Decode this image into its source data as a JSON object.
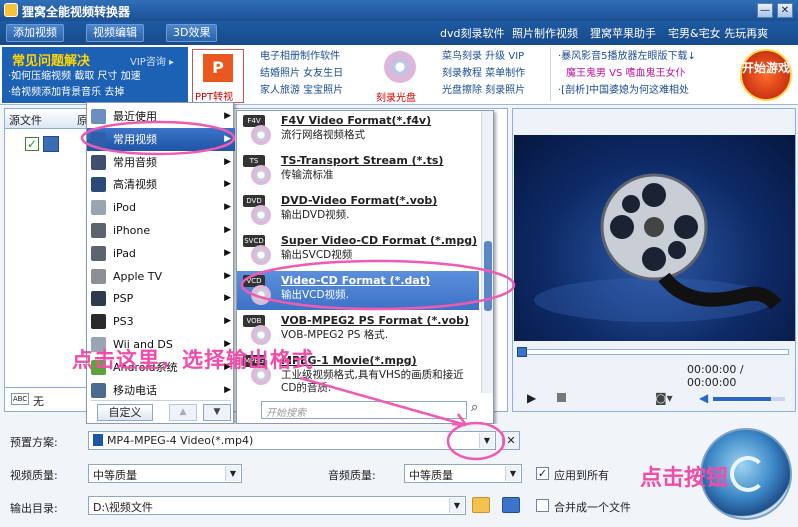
{
  "window": {
    "title": "狸窝全能视频转换器",
    "min_label": "—",
    "close_label": "✕"
  },
  "toolbar": {
    "buttons": [
      "添加视频",
      "视频编辑",
      "3D效果"
    ],
    "links": [
      "dvd刻录软件",
      "照片制作视频",
      "狸窝苹果助手",
      "宅男&宅女 先玩再爽"
    ]
  },
  "ads": {
    "faq_title": "常见问题解决",
    "vip": "VIP咨询 ▸",
    "faq_lines": [
      "·如何压缩视频 截取 尺寸 加速",
      "·给视频添加背景音乐 去掉"
    ],
    "ppt_label": "PPT转视频",
    "photo_lines": [
      "电子相册制作软件",
      "结婚照片 女友生日",
      "家人旅游 宝宝照片"
    ],
    "burn_label": "刻录光盘",
    "burn_lines": [
      "菜鸟刻录 升级 VIP",
      "刻录教程 菜单制作",
      "光盘擦除 刻录照片"
    ],
    "news_lines": [
      "·暴风影音5播放器左眼版下载↓",
      "魔王鬼男 VS 嗜血鬼王女仆",
      "·[剖析]中国婆媳为何这难相处"
    ],
    "game_label": "开始游戏"
  },
  "left_panel": {
    "col1": "源文件",
    "col2": "原",
    "audio_value": "无"
  },
  "menu1": {
    "items": [
      {
        "label": "最近使用",
        "icon": "clock-icon",
        "selected": false
      },
      {
        "label": "常用视频",
        "icon": "film-icon",
        "selected": true
      },
      {
        "label": "常用音频",
        "icon": "music-icon",
        "selected": false
      },
      {
        "label": "高清视频",
        "icon": "hd-icon",
        "selected": false
      },
      {
        "label": "iPod",
        "icon": "ipod-icon",
        "selected": false
      },
      {
        "label": "iPhone",
        "icon": "iphone-icon",
        "selected": false
      },
      {
        "label": "iPad",
        "icon": "ipad-icon",
        "selected": false
      },
      {
        "label": "Apple TV",
        "icon": "apple-icon",
        "selected": false
      },
      {
        "label": "PSP",
        "icon": "psp-icon",
        "selected": false
      },
      {
        "label": "PS3",
        "icon": "ps3-icon",
        "selected": false
      },
      {
        "label": "Wii and DS",
        "icon": "wii-icon",
        "selected": false
      },
      {
        "label": "Android系统",
        "icon": "android-icon",
        "selected": false
      },
      {
        "label": "移动电话",
        "icon": "phone-icon",
        "selected": false
      }
    ],
    "custom_label": "自定义",
    "up_label": "▲",
    "down_label": "▼"
  },
  "menu2": {
    "items": [
      {
        "title": "F4V Video Format(*.f4v)",
        "desc": "流行网络视频格式",
        "icon": "F4V",
        "selected": false
      },
      {
        "title": "TS-Transport Stream (*.ts)",
        "desc": "传输流标准",
        "icon": "TS",
        "selected": false
      },
      {
        "title": "DVD-Video Format(*.vob)",
        "desc": "输出DVD视频.",
        "icon": "DVD",
        "selected": false
      },
      {
        "title": "Super Video-CD Format (*.mpg)",
        "desc": "输出SVCD视频",
        "icon": "SVCD",
        "selected": false
      },
      {
        "title": "Video-CD Format (*.dat)",
        "desc": "输出VCD视频.",
        "icon": "VCD",
        "selected": true
      },
      {
        "title": "VOB-MPEG2 PS Format (*.vob)",
        "desc": "VOB-MPEG2 PS 格式.",
        "icon": "VOB",
        "selected": false
      },
      {
        "title": "MPEG-1 Movie(*.mpg)",
        "desc": "工业级视频格式,具有VHS的画质和接近CD的音质.",
        "icon": "MPEG",
        "selected": false
      }
    ],
    "search_placeholder": "开始搜索"
  },
  "preview": {
    "time": "00:00:00 / 00:00:00",
    "progress": 0,
    "volume": 0.8
  },
  "settings": {
    "preset_label": "预置方案:",
    "preset_value": "MP4-MPEG-4 Video(*.mp4)",
    "video_quality_label": "视频质量:",
    "video_quality_value": "中等质量",
    "audio_quality_label": "音频质量:",
    "audio_quality_value": "中等质量",
    "apply_all_label": "应用到所有",
    "apply_all_checked": true,
    "output_label": "输出目录:",
    "output_value": "D:\\视频文件",
    "merge_label": "合并成一个文件",
    "merge_checked": false
  },
  "annotations": {
    "select_format": "点击这里，选择输出格式",
    "click_button": "点击按钮"
  }
}
